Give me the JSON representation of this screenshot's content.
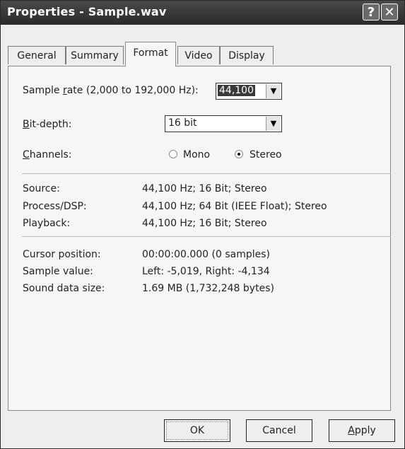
{
  "window": {
    "title": "Properties - Sample.wav"
  },
  "titlebar": {
    "help_glyph": "?",
    "close_glyph": "✕"
  },
  "tabs": [
    {
      "label": "General",
      "active": false
    },
    {
      "label": "Summary",
      "active": false
    },
    {
      "label": "Format",
      "active": true
    },
    {
      "label": "Video",
      "active": false
    },
    {
      "label": "Display",
      "active": false
    }
  ],
  "format": {
    "sample_rate": {
      "label_pre": "Sample ",
      "label_ul": "r",
      "label_post": "ate (2,000 to 192,000 Hz):",
      "value": "44,100"
    },
    "bit_depth": {
      "label_ul": "B",
      "label_post": "it-depth:",
      "value": "16 bit"
    },
    "channels": {
      "label_ul": "C",
      "label_post": "hannels:",
      "options": [
        {
          "label": "Mono",
          "checked": false
        },
        {
          "label": "Stereo",
          "checked": true
        }
      ]
    },
    "info": [
      {
        "label": "Source:",
        "value": "44,100 Hz; 16 Bit; Stereo"
      },
      {
        "label": "Process/DSP:",
        "value": "44,100 Hz; 64 Bit (IEEE Float); Stereo"
      },
      {
        "label": "Playback:",
        "value": "44,100 Hz; 16 Bit; Stereo"
      }
    ],
    "stats": [
      {
        "label": "Cursor position:",
        "value": "00:00:00.000  (0 samples)"
      },
      {
        "label": "Sample value:",
        "value": "Left: -5,019, Right: -4,134"
      },
      {
        "label": "Sound data size:",
        "value": "1.69 MB (1,732,248 bytes)"
      }
    ]
  },
  "buttons": {
    "ok": "OK",
    "cancel": "Cancel",
    "apply_ul": "A",
    "apply_post": "pply"
  }
}
